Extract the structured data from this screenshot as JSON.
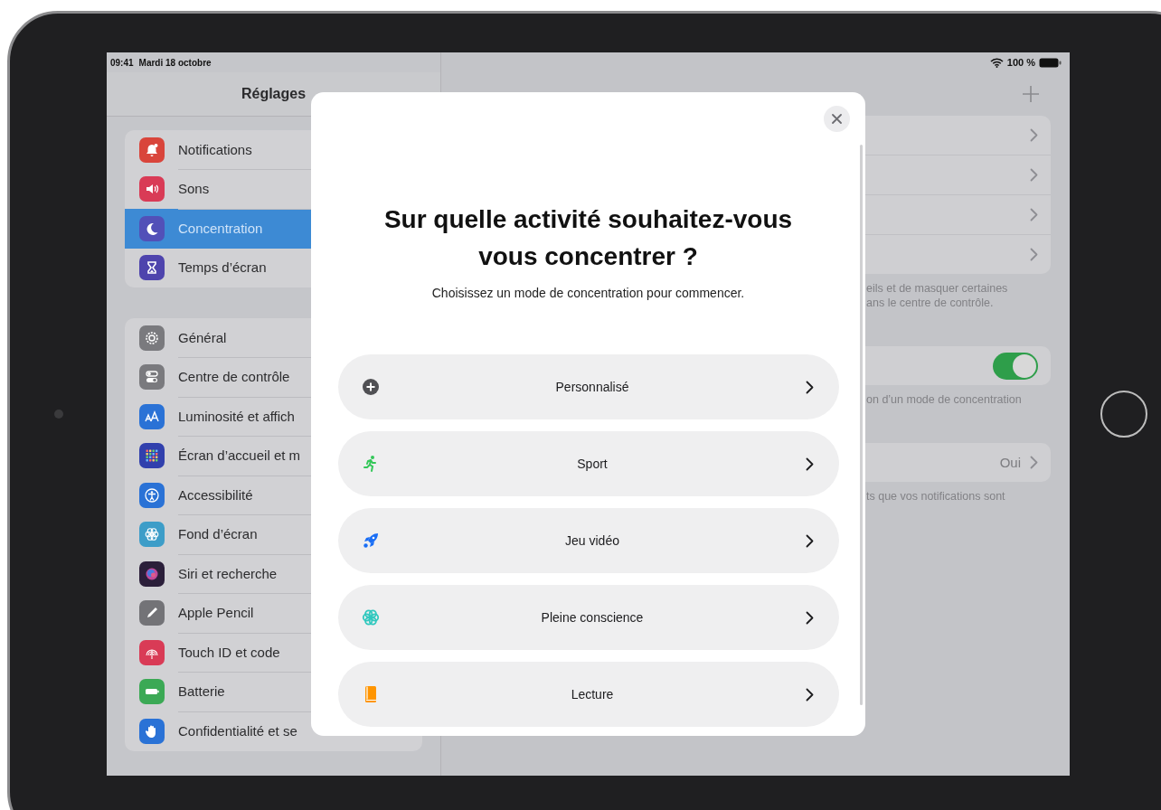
{
  "status_bar": {
    "time": "09:41",
    "date": "Mardi 18 octobre",
    "battery": "100 %"
  },
  "sidebar": {
    "title": "Réglages",
    "groups": [
      {
        "items": [
          {
            "label": "Notifications",
            "kind": "bell",
            "color": "#d9453b",
            "selected": false
          },
          {
            "label": "Sons",
            "kind": "speaker",
            "color": "#d93b56",
            "selected": false
          },
          {
            "label": "Concentration",
            "kind": "moon",
            "color": "#5250b8",
            "selected": true
          },
          {
            "label": "Temps d’écran",
            "kind": "hourglass",
            "color": "#4e44ad",
            "selected": false
          }
        ]
      },
      {
        "items": [
          {
            "label": "Général",
            "kind": "gear",
            "color": "#7a7a7e",
            "selected": false
          },
          {
            "label": "Centre de contrôle",
            "kind": "switches",
            "color": "#7a7a7e",
            "selected": false
          },
          {
            "label": "Luminosité et affich",
            "kind": "textsize",
            "color": "#2a72d6",
            "selected": false
          },
          {
            "label": "Écran d’accueil et m",
            "kind": "grid",
            "color": "#3140ad",
            "selected": false
          },
          {
            "label": "Accessibilité",
            "kind": "person",
            "color": "#2a72d6",
            "selected": false
          },
          {
            "label": "Fond d’écran",
            "kind": "flower",
            "color": "#3d9dc8",
            "selected": false
          },
          {
            "label": "Siri et recherche",
            "kind": "orb",
            "color": "#2b1f3a",
            "selected": false
          },
          {
            "label": "Apple Pencil",
            "kind": "pencil",
            "color": "#737377",
            "selected": false
          },
          {
            "label": "Touch ID et code",
            "kind": "fingerprint",
            "color": "#d93b56",
            "selected": false
          },
          {
            "label": "Batterie",
            "kind": "battery",
            "color": "#3ba955",
            "selected": false
          },
          {
            "label": "Confidentialité et se",
            "kind": "hand",
            "color": "#2a72d6",
            "selected": false
          }
        ]
      }
    ]
  },
  "detail": {
    "sections": [
      {
        "rows": [
          {
            "kind": "link"
          },
          {
            "kind": "link"
          },
          {
            "kind": "link"
          },
          {
            "kind": "link"
          }
        ],
        "footnote_lines": [
          "eils et de masquer certaines",
          "ans le centre de contrôle."
        ]
      },
      {
        "rows": [
          {
            "kind": "toggle",
            "on": true
          }
        ],
        "footnote_lines": [
          "on d’un mode de concentration"
        ]
      },
      {
        "rows": [
          {
            "kind": "value",
            "value": "Oui"
          }
        ],
        "footnote_lines": [
          "ts que vos notifications sont"
        ]
      }
    ]
  },
  "modal": {
    "title": "Sur quelle activité souhaitez-vous vous concentrer ?",
    "subtitle": "Choisissez un mode de concentration pour commencer.",
    "options": [
      {
        "label": "Personnalisé",
        "kind": "plus",
        "color": "#505054"
      },
      {
        "label": "Sport",
        "kind": "runner",
        "color": "#34c759"
      },
      {
        "label": "Jeu vidéo",
        "kind": "rocket",
        "color": "#1a6ef5"
      },
      {
        "label": "Pleine conscience",
        "kind": "flower",
        "color": "#30c8be"
      },
      {
        "label": "Lecture",
        "kind": "book",
        "color": "#ff9500"
      }
    ]
  }
}
